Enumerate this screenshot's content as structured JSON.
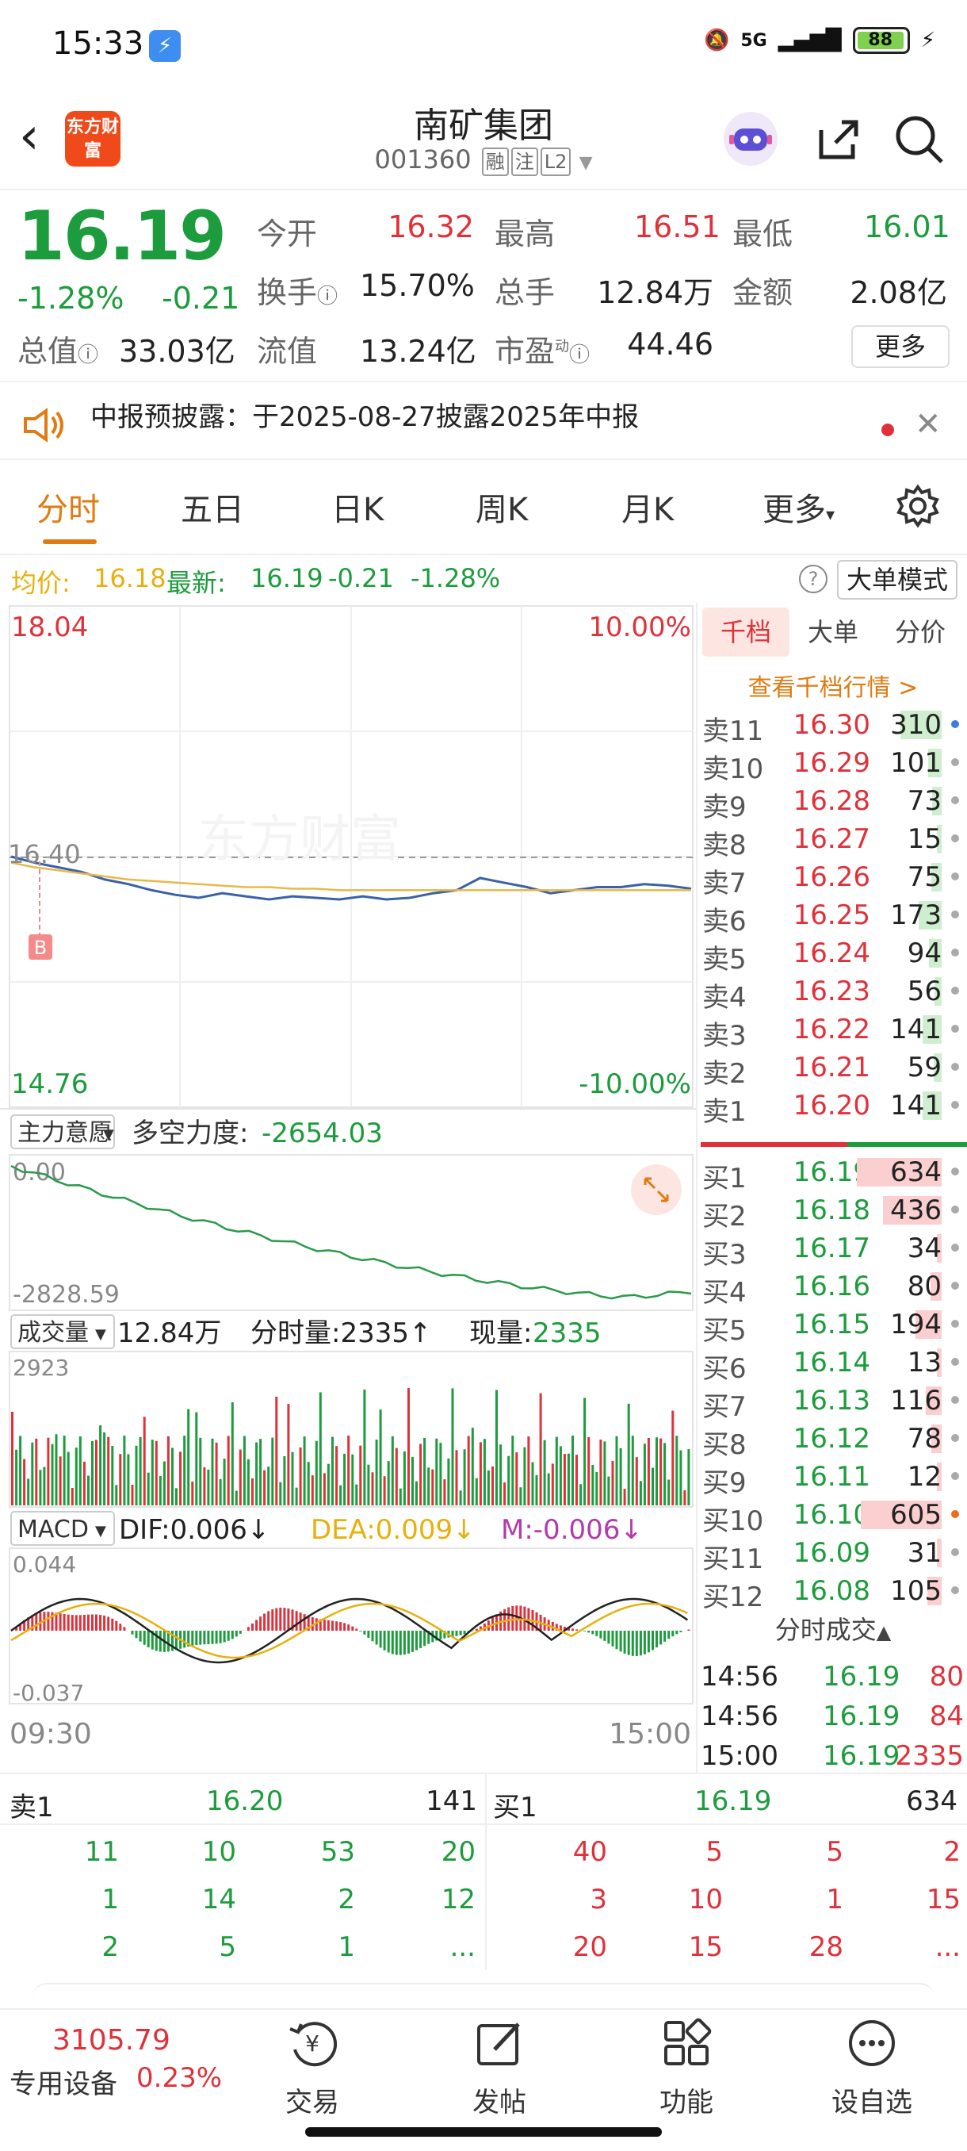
{
  "status_bar": {
    "time": "15:33",
    "network": "5G",
    "battery": "88"
  },
  "header": {
    "title": "南矿集团",
    "code": "001360",
    "tags": [
      "融",
      "注",
      "L2"
    ],
    "logo_text": "东方财富"
  },
  "quote": {
    "price": "16.19",
    "change_pct": "-1.28%",
    "change": "-0.21",
    "open_label": "今开",
    "open": "16.32",
    "high_label": "最高",
    "high": "16.51",
    "low_label": "最低",
    "low": "16.01",
    "turnover_label": "换手",
    "turnover": "15.70%",
    "volume_label": "总手",
    "volume": "12.84万",
    "amount_label": "金额",
    "amount": "2.08亿",
    "mktcap_label": "总值",
    "mktcap": "33.03亿",
    "float_label": "流值",
    "float": "13.24亿",
    "pe_label": "市盈",
    "pe_sup": "动",
    "pe": "44.46",
    "more_button": "更多"
  },
  "notice": {
    "text": "中报预披露：于2025-08-27披露2025年中报"
  },
  "tabs": [
    "分时",
    "五日",
    "日K",
    "周K",
    "月K",
    "更多"
  ],
  "avg_info": {
    "avg_label": "均价:",
    "avg": "16.18",
    "latest_label": "最新:",
    "latest": "16.19",
    "change": "-0.21",
    "change_pct": "-1.28%",
    "mode_button": "大单模式"
  },
  "colors": {
    "up": "#e0313a",
    "down": "#1c9c3c",
    "accent": "#e07b12",
    "price_line": "#3a62a8",
    "avg_line": "#e8b84a"
  },
  "chart_labels": {
    "price_top": "18.04",
    "price_bottom": "14.76",
    "price_mid": "16.40",
    "pct_top": "10.00%",
    "pct_bottom": "-10.00%",
    "marker": "B",
    "main_intent_label": "主力意愿",
    "strength_label": "多空力度:",
    "strength_value": "-2654.03",
    "intent_top": "0.00",
    "intent_bottom": "-2828.59",
    "volume_label": "成交量",
    "volume_total": "12.84万",
    "tick_volume": "分时量:2335↑",
    "current_volume_label": "现量:",
    "current_volume": "2335",
    "volume_max": "2923",
    "macd_label": "MACD",
    "dif": "DIF:0.006↓",
    "dea": "DEA:0.009↓",
    "m": "M:-0.006↓",
    "macd_top": "0.044",
    "macd_bottom": "-0.037",
    "time_start": "09:30",
    "time_end": "15:00"
  },
  "chart_data": {
    "type": "line",
    "x_range": [
      "09:30",
      "15:00"
    ],
    "ylim": [
      14.76,
      18.04
    ],
    "prev_close": 16.4,
    "series": [
      {
        "name": "price",
        "values": [
          16.4,
          16.36,
          16.33,
          16.3,
          16.25,
          16.22,
          16.18,
          16.15,
          16.13,
          16.16,
          16.14,
          16.12,
          16.14,
          16.13,
          16.12,
          16.14,
          16.12,
          16.13,
          16.16,
          16.18,
          16.26,
          16.23,
          16.2,
          16.16,
          16.18,
          16.2,
          16.2,
          16.22,
          16.21,
          16.19
        ]
      },
      {
        "name": "avg",
        "values": [
          16.36,
          16.33,
          16.31,
          16.29,
          16.27,
          16.25,
          16.24,
          16.23,
          16.22,
          16.21,
          16.2,
          16.2,
          16.19,
          16.19,
          16.18,
          16.18,
          16.18,
          16.18,
          16.18,
          16.18,
          16.18,
          16.18,
          16.18,
          16.18,
          16.18,
          16.18,
          16.18,
          16.18,
          16.18,
          16.18
        ]
      }
    ]
  },
  "order_book": {
    "tabs": [
      "千档",
      "大单",
      "分价"
    ],
    "link": "查看千档行情 >",
    "sells": [
      {
        "label": "卖11",
        "price": "16.30",
        "vol": "310",
        "dot": "#3d7de0"
      },
      {
        "label": "卖10",
        "price": "16.29",
        "vol": "101",
        "dot": "#aaa"
      },
      {
        "label": "卖9",
        "price": "16.28",
        "vol": "73",
        "dot": "#aaa"
      },
      {
        "label": "卖8",
        "price": "16.27",
        "vol": "15",
        "dot": "#aaa"
      },
      {
        "label": "卖7",
        "price": "16.26",
        "vol": "75",
        "dot": "#aaa"
      },
      {
        "label": "卖6",
        "price": "16.25",
        "vol": "173",
        "dot": "#aaa"
      },
      {
        "label": "卖5",
        "price": "16.24",
        "vol": "94",
        "dot": "#aaa"
      },
      {
        "label": "卖4",
        "price": "16.23",
        "vol": "56",
        "dot": "#aaa"
      },
      {
        "label": "卖3",
        "price": "16.22",
        "vol": "141",
        "dot": "#aaa"
      },
      {
        "label": "卖2",
        "price": "16.21",
        "vol": "59",
        "dot": "#aaa"
      },
      {
        "label": "卖1",
        "price": "16.20",
        "vol": "141",
        "dot": "#aaa"
      }
    ],
    "buys": [
      {
        "label": "买1",
        "price": "16.19",
        "vol": "634",
        "dot": "#aaa"
      },
      {
        "label": "买2",
        "price": "16.18",
        "vol": "436",
        "dot": "#aaa"
      },
      {
        "label": "买3",
        "price": "16.17",
        "vol": "34",
        "dot": "#aaa"
      },
      {
        "label": "买4",
        "price": "16.16",
        "vol": "80",
        "dot": "#aaa"
      },
      {
        "label": "买5",
        "price": "16.15",
        "vol": "194",
        "dot": "#aaa"
      },
      {
        "label": "买6",
        "price": "16.14",
        "vol": "13",
        "dot": "#aaa"
      },
      {
        "label": "买7",
        "price": "16.13",
        "vol": "116",
        "dot": "#aaa"
      },
      {
        "label": "买8",
        "price": "16.12",
        "vol": "78",
        "dot": "#aaa"
      },
      {
        "label": "买9",
        "price": "16.11",
        "vol": "12",
        "dot": "#aaa"
      },
      {
        "label": "买10",
        "price": "16.10",
        "vol": "605",
        "dot": "#f06a1a"
      },
      {
        "label": "买11",
        "price": "16.09",
        "vol": "31",
        "dot": "#aaa"
      },
      {
        "label": "买12",
        "price": "16.08",
        "vol": "105",
        "dot": "#aaa"
      }
    ],
    "trades_label": "分时成交",
    "trades": [
      {
        "time": "14:56",
        "price": "16.19",
        "vol": "80"
      },
      {
        "time": "14:56",
        "price": "16.19",
        "vol": "84"
      },
      {
        "time": "15:00",
        "price": "16.19",
        "vol": "2335"
      }
    ]
  },
  "summary": {
    "sell_label": "卖1",
    "sell_price": "16.20",
    "sell_vol": "141",
    "buy_label": "买1",
    "buy_price": "16.19",
    "buy_vol": "634",
    "sell_queue": [
      [
        "11",
        "10",
        "53",
        "20"
      ],
      [
        "1",
        "14",
        "2",
        "12"
      ],
      [
        "2",
        "5",
        "1",
        "..."
      ]
    ],
    "buy_queue": [
      [
        "40",
        "5",
        "5",
        "2"
      ],
      [
        "3",
        "10",
        "1",
        "15"
      ],
      [
        "20",
        "15",
        "28",
        "..."
      ]
    ]
  },
  "bottom_nav": {
    "index_value": "3105.79",
    "index_label": "专用设备",
    "index_change": "0.23%",
    "items": [
      {
        "label": "交易",
        "icon": "yuan-cycle-icon"
      },
      {
        "label": "发帖",
        "icon": "edit-icon"
      },
      {
        "label": "功能",
        "icon": "grid-icon"
      },
      {
        "label": "设自选",
        "icon": "more-circle-icon"
      }
    ]
  }
}
